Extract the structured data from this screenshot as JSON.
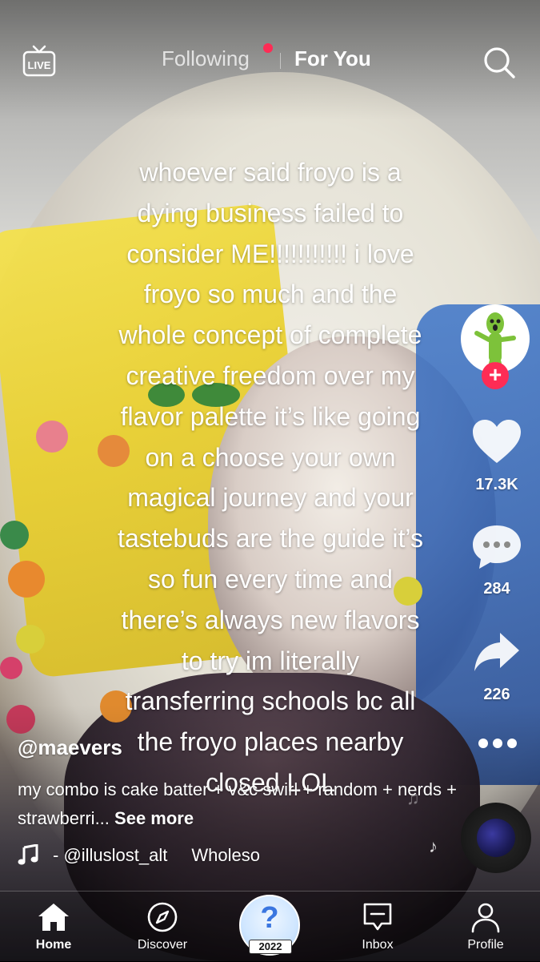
{
  "top_nav": {
    "live_label": "LIVE",
    "tabs": [
      {
        "label": "Following",
        "active": false,
        "has_dot": true
      },
      {
        "label": "For You",
        "active": true
      }
    ]
  },
  "overlay_caption": "whoever said froyo is a\ndying business failed to\nconsider ME!!!!!!!!!!! i love\nfroyo so much and the\nwhole concept of complete\ncreative freedom over my\nflavor palette it’s like going\non a choose your own\nmagical journey and your\ntastebuds are the guide it’s\nso fun every time and\nthere’s always new flavors\nto try im literally\ntransferring schools bc all\nthe froyo places nearby\nclosed LOL",
  "right_rail": {
    "likes": "17.3K",
    "comments": "284",
    "shares": "226"
  },
  "post": {
    "username": "@maevers",
    "description": "my combo is cake batter + v&c swirl + random + nerds + strawberri...",
    "see_more": "See more",
    "music_credit": "- @illuslost_alt",
    "music_title": "Wholeso"
  },
  "bottom_tabs": {
    "home": "Home",
    "discover": "Discover",
    "center_badge": "2022",
    "center_symbol": "?",
    "inbox": "Inbox",
    "profile": "Profile"
  },
  "colors": {
    "accent_red": "#fe2c55",
    "text_white": "#ffffff"
  }
}
